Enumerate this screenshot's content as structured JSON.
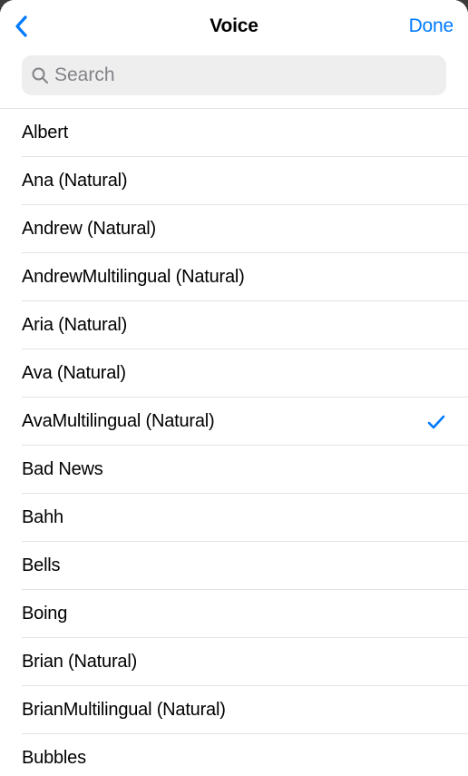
{
  "header": {
    "title": "Voice",
    "done_label": "Done"
  },
  "search": {
    "placeholder": "Search"
  },
  "colors": {
    "accent": "#007aff",
    "icon_gray": "#828287"
  },
  "voices": [
    {
      "label": "Albert",
      "selected": false
    },
    {
      "label": "Ana (Natural)",
      "selected": false
    },
    {
      "label": "Andrew (Natural)",
      "selected": false
    },
    {
      "label": "AndrewMultilingual (Natural)",
      "selected": false
    },
    {
      "label": "Aria (Natural)",
      "selected": false
    },
    {
      "label": "Ava (Natural)",
      "selected": false
    },
    {
      "label": "AvaMultilingual (Natural)",
      "selected": true
    },
    {
      "label": "Bad News",
      "selected": false
    },
    {
      "label": "Bahh",
      "selected": false
    },
    {
      "label": "Bells",
      "selected": false
    },
    {
      "label": "Boing",
      "selected": false
    },
    {
      "label": "Brian (Natural)",
      "selected": false
    },
    {
      "label": "BrianMultilingual (Natural)",
      "selected": false
    },
    {
      "label": "Bubbles",
      "selected": false
    }
  ]
}
